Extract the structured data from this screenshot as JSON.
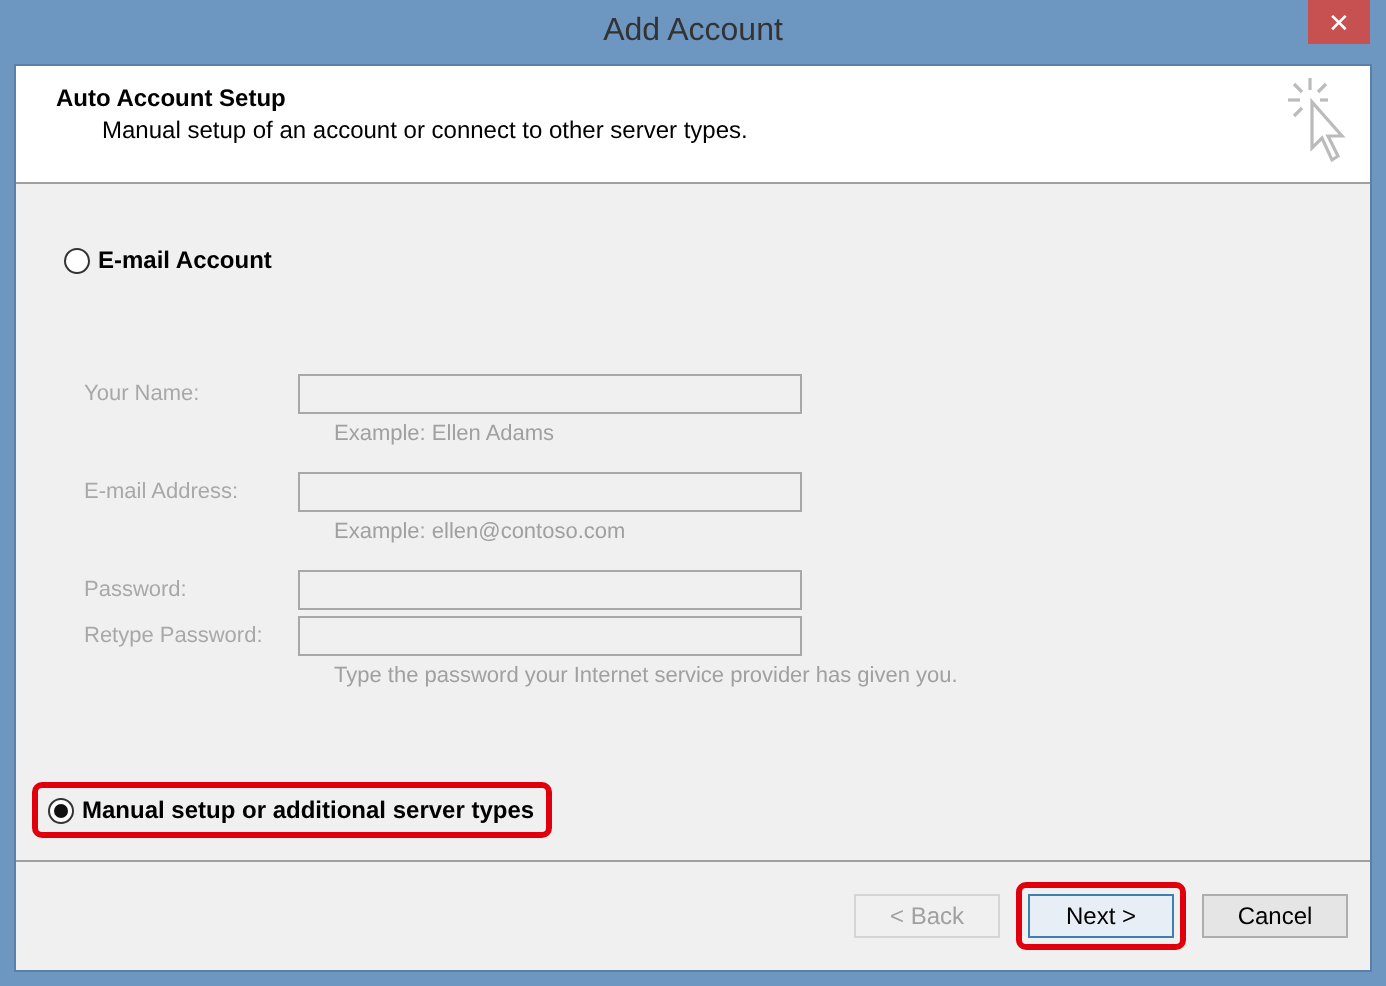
{
  "window": {
    "title": "Add Account",
    "close": "✕"
  },
  "header": {
    "title": "Auto Account Setup",
    "subtitle": "Manual setup of an account or connect to other server types."
  },
  "options": [
    {
      "label": "E-mail Account",
      "selected": false,
      "highlighted": false
    },
    {
      "label": "Manual setup or additional server types",
      "selected": true,
      "highlighted": true
    }
  ],
  "fields": [
    {
      "label": "Your Name:",
      "disabled": true,
      "hint": "Example: Ellen Adams"
    },
    {
      "label": "E-mail Address:",
      "disabled": true,
      "hint": "Example: ellen@contoso.com"
    },
    {
      "label": "Password:",
      "disabled": true
    },
    {
      "label": "Retype Password:",
      "disabled": true,
      "hint": "Type the password your Internet service provider has given you."
    }
  ],
  "buttons": [
    {
      "label": "< Back",
      "disabled": true,
      "highlighted": false,
      "focused": false
    },
    {
      "label": "Next >",
      "disabled": false,
      "highlighted": true,
      "focused": true
    },
    {
      "label": "Cancel",
      "disabled": false,
      "highlighted": false,
      "focused": false
    }
  ]
}
